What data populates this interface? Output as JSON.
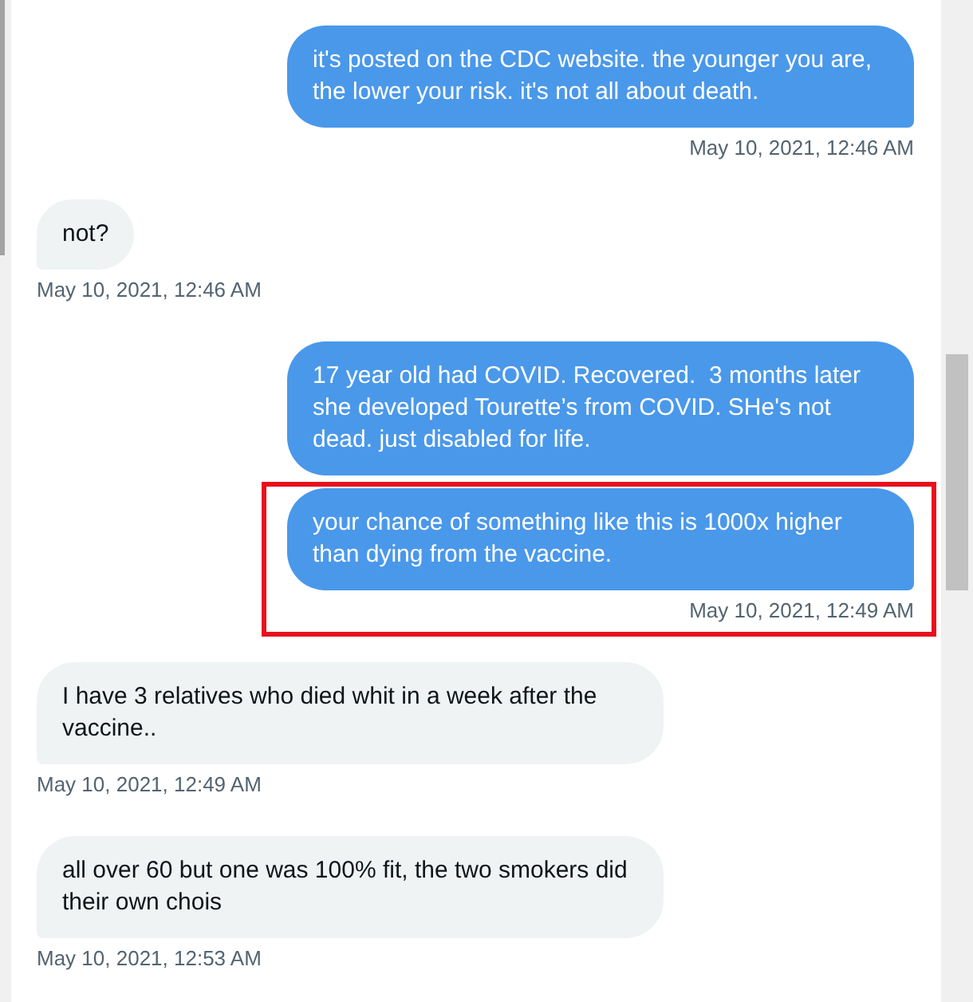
{
  "conversation": {
    "messages": [
      {
        "kind": "sent",
        "text": "it's posted on the CDC website. the younger you are, the lower your risk. it's not all about death.",
        "timestamp": "May 10, 2021, 12:46 AM",
        "highlighted": false
      },
      {
        "kind": "received",
        "text": "not?",
        "timestamp": "May 10, 2021, 12:46 AM",
        "highlighted": false
      },
      {
        "kind": "sent",
        "text": "17 year old had COVID. Recovered.  3 months later she developed Tourette’s from COVID. SHe's not dead. just disabled for life.",
        "highlighted": false
      },
      {
        "kind": "sent",
        "text": "your chance of something like this is 1000x higher than dying from the vaccine.",
        "timestamp": "May 10, 2021, 12:49 AM",
        "highlighted": true
      },
      {
        "kind": "received",
        "text": "I have 3 relatives who died whit in a week after the vaccine..",
        "timestamp": "May 10, 2021, 12:49 AM",
        "highlighted": false
      },
      {
        "kind": "received",
        "text": "all over 60 but one was 100% fit, the two smokers did their own chois",
        "timestamp": "May 10, 2021, 12:53 AM",
        "highlighted": false
      }
    ]
  }
}
